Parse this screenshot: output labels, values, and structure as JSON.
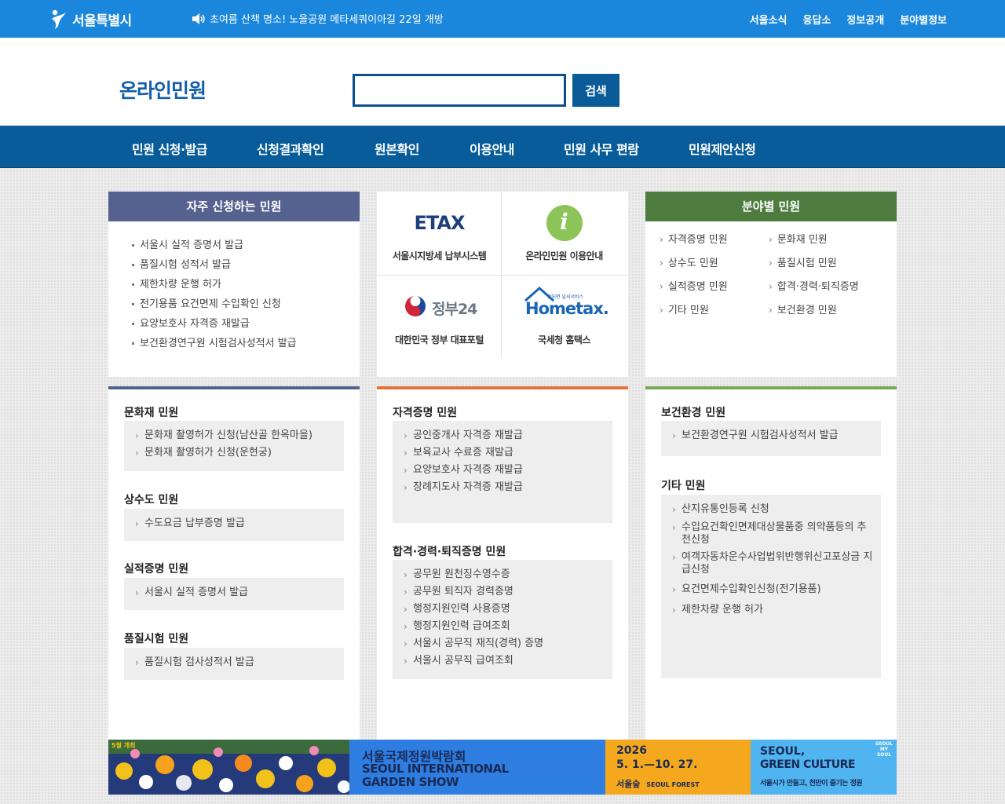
{
  "topbar": {
    "logo_text": "서울특별시",
    "notice": "초여름 산책 명소! 노을공원 메타세쿼이아길 22일 개방",
    "links": [
      "서울소식",
      "응답소",
      "정보공개",
      "분야별정보"
    ]
  },
  "header": {
    "title": "온라인민원",
    "search_value": "",
    "search_button": "검색"
  },
  "nav": [
    "민원 신청·발급",
    "신청결과확인",
    "원본확인",
    "이용안내",
    "민원 사무 편람",
    "민원제안신청"
  ],
  "frequent": {
    "title": "자주 신청하는 민원",
    "items": [
      "서울시 실적 증명서 발급",
      "품질시험 성적서 발급",
      "제한차량 운행 허가",
      "전기용품 요건면제 수입확인 신청",
      "요양보호사 자격증 재발급",
      "보건환경연구원 시험검사성적서 발급"
    ]
  },
  "quick": [
    {
      "logo": "ETAX",
      "label": "서울시지방세 납부시스템"
    },
    {
      "logo": "i",
      "label": "온라인민원 이용안내"
    },
    {
      "logo": "정부24",
      "label": "대한민국 정부 대표포털"
    },
    {
      "logo": "Hometax.",
      "logo_small": "안되면 날씨서비스",
      "label": "국세청 홈택스"
    }
  ],
  "field": {
    "title": "분야별 민원",
    "items": [
      "자격증명 민원",
      "문화재 민원",
      "상수도 민원",
      "품질시험 민원",
      "실적증명 민원",
      "합격·경력·퇴직증명",
      "기타 민원",
      "보건환경 민원"
    ]
  },
  "categories": {
    "culture": {
      "title": "문화재 민원",
      "items": [
        "문화재 촬영허가 신청(남산골 한옥마을)",
        "문화재 촬영허가 신청(운현궁)"
      ]
    },
    "water": {
      "title": "상수도 민원",
      "items": [
        "수도요금 납부증명 발급"
      ]
    },
    "perf": {
      "title": "실적증명 민원",
      "items": [
        "서울시 실적 증명서 발급"
      ]
    },
    "quality": {
      "title": "품질시험 민원",
      "items": [
        "품질시험 검사성적서 발급"
      ]
    },
    "license": {
      "title": "자격증명 민원",
      "items": [
        "공인중개사 자격증 재발급",
        "보육교사 수료증 재발급",
        "요양보호사 자격증 재발급",
        "장례지도사 자격증 재발급"
      ]
    },
    "career": {
      "title": "합격·경력·퇴직증명 민원",
      "items": [
        "공무원 원천징수영수증",
        "공무원 퇴직자 경력증명",
        "행정지원인력 사용증명",
        "행정지원인력 급여조회",
        "서울시 공무직 재직(경력) 증명",
        "서울시 공무직 급여조회"
      ]
    },
    "health": {
      "title": "보건환경 민원",
      "items": [
        "보건환경연구원 시험검사성적서 발급"
      ]
    },
    "etc": {
      "title": "기타 민원",
      "items": [
        "산지유통인등록 신청",
        "수입요건확인면제대상물품중 의약품등의 추천신청",
        "여객자동차운수사업법위반행위신고포상금 지급신청",
        "요건면제수입확인신청(전기용품)",
        "제한차량 운행 허가"
      ]
    }
  },
  "banner": {
    "title_ko": "서울국제정원박람회",
    "title_en_1": "SEOUL INTERNATIONAL",
    "title_en_2": "GARDEN SHOW",
    "year": "2026",
    "dates": "5. 1.—10. 27.",
    "venue_ko": "서울숲",
    "venue_en": "SEOUL FOREST",
    "slogan_1": "SEOUL,",
    "slogan_2": "GREEN CULTURE",
    "slogan_sub": "서울시가 만들고, 천만이 즐기는 정원",
    "badge": "SEOUL MY SOUL",
    "corner": "5월 개최"
  },
  "colors": {
    "topbar": "#1a87dc",
    "nav": "#075c99",
    "frequent_head": "#55628f",
    "field_head": "#4e7c3e",
    "culture_bar": "#55628f",
    "license_bar": "#e0743a",
    "health_bar": "#7aa85a"
  }
}
